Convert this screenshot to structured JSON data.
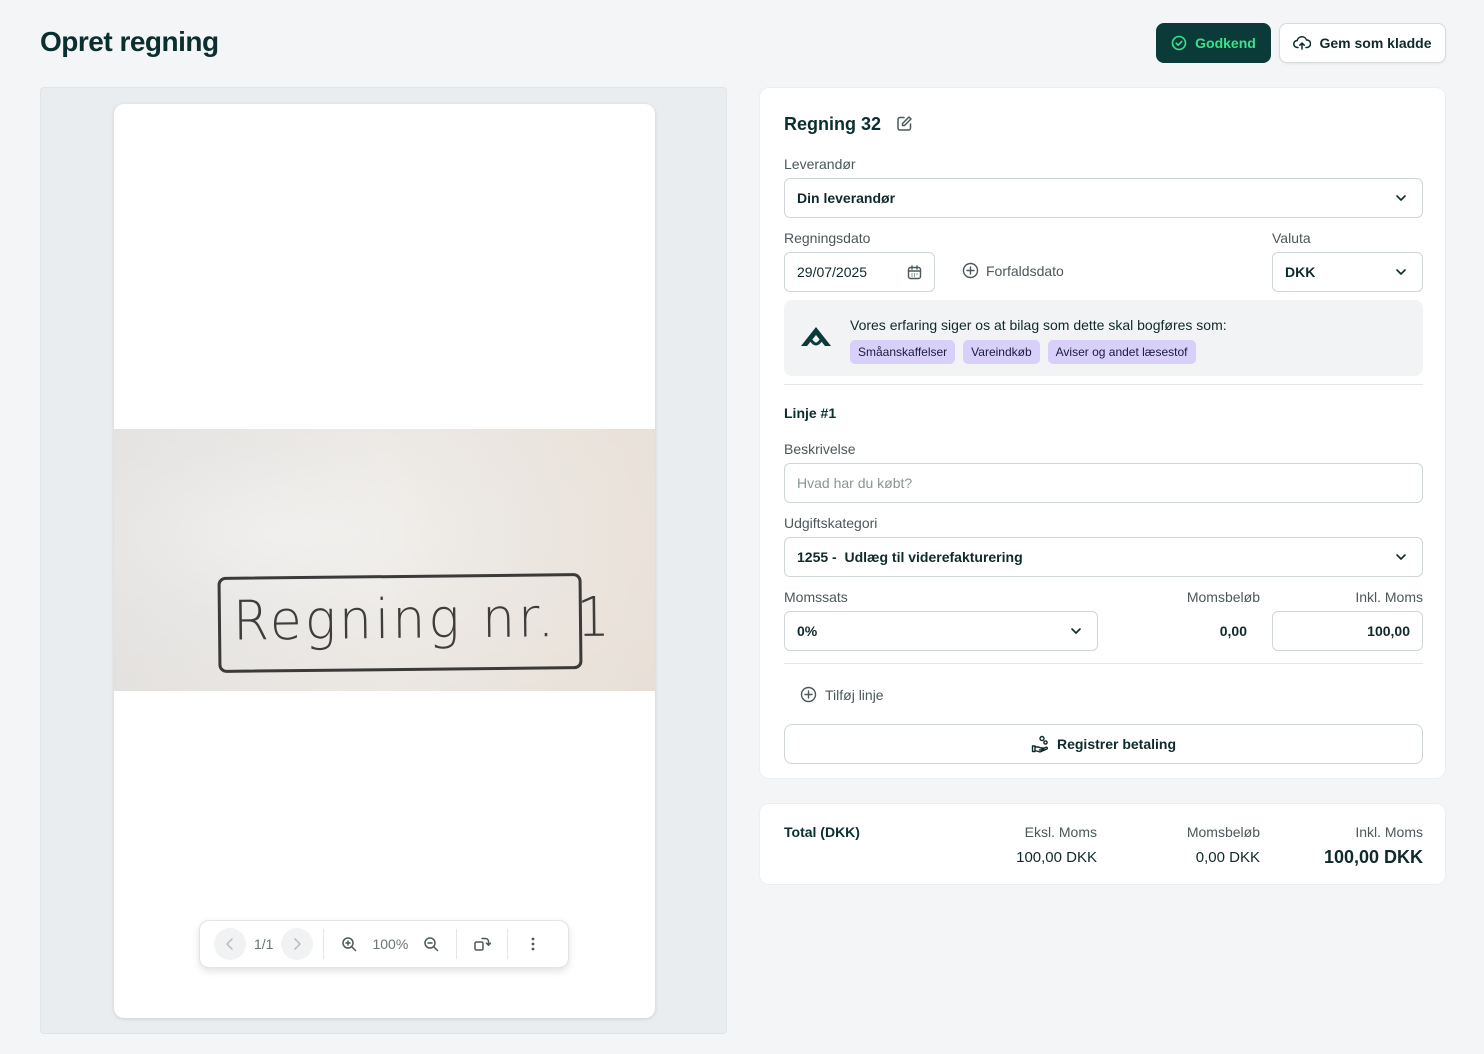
{
  "page": {
    "title": "Opret regning"
  },
  "actions": {
    "approve_label": "Godkend",
    "save_draft_label": "Gem som kladde"
  },
  "preview": {
    "receipt_text": "Regning nr. 1",
    "page_indicator": "1/1",
    "zoom": "100%"
  },
  "bill": {
    "title": "Regning 32",
    "supplier_label": "Leverandør",
    "supplier_value": "Din leverandør",
    "date_label": "Regningsdato",
    "date_value": "29/07/2025",
    "due_date_link": "Forfaldsdato",
    "currency_label": "Valuta",
    "currency_value": "DKK",
    "suggestion_text": "Vores erfaring siger os at bilag som dette skal bogføres som:",
    "suggestions": [
      "Småanskaffelser",
      "Vareindkøb",
      "Aviser og andet læsestof"
    ],
    "line_title": "Linje #1",
    "description_label": "Beskrivelse",
    "description_placeholder": "Hvad har du købt?",
    "category_label": "Udgiftskategori",
    "category_value": "1255 -  Udlæg til viderefakturering",
    "vat_rate_label": "Momssats",
    "vat_rate_value": "0%",
    "vat_amount_label": "Momsbeløb",
    "vat_amount_value": "0,00",
    "incl_vat_label": "Inkl. Moms",
    "incl_vat_value": "100,00",
    "add_line_label": "Tilføj linje",
    "register_payment_label": "Registrer betaling"
  },
  "total": {
    "label": "Total (DKK)",
    "excl_label": "Eksl. Moms",
    "excl_value": "100,00 DKK",
    "vat_label": "Momsbeløb",
    "vat_value": "0,00 DKK",
    "incl_label": "Inkl. Moms",
    "incl_value": "100,00 DKK"
  },
  "colors": {
    "brand_dark": "#0b3b38",
    "brand_green": "#3ee08a",
    "chip": "#d8cffb"
  }
}
